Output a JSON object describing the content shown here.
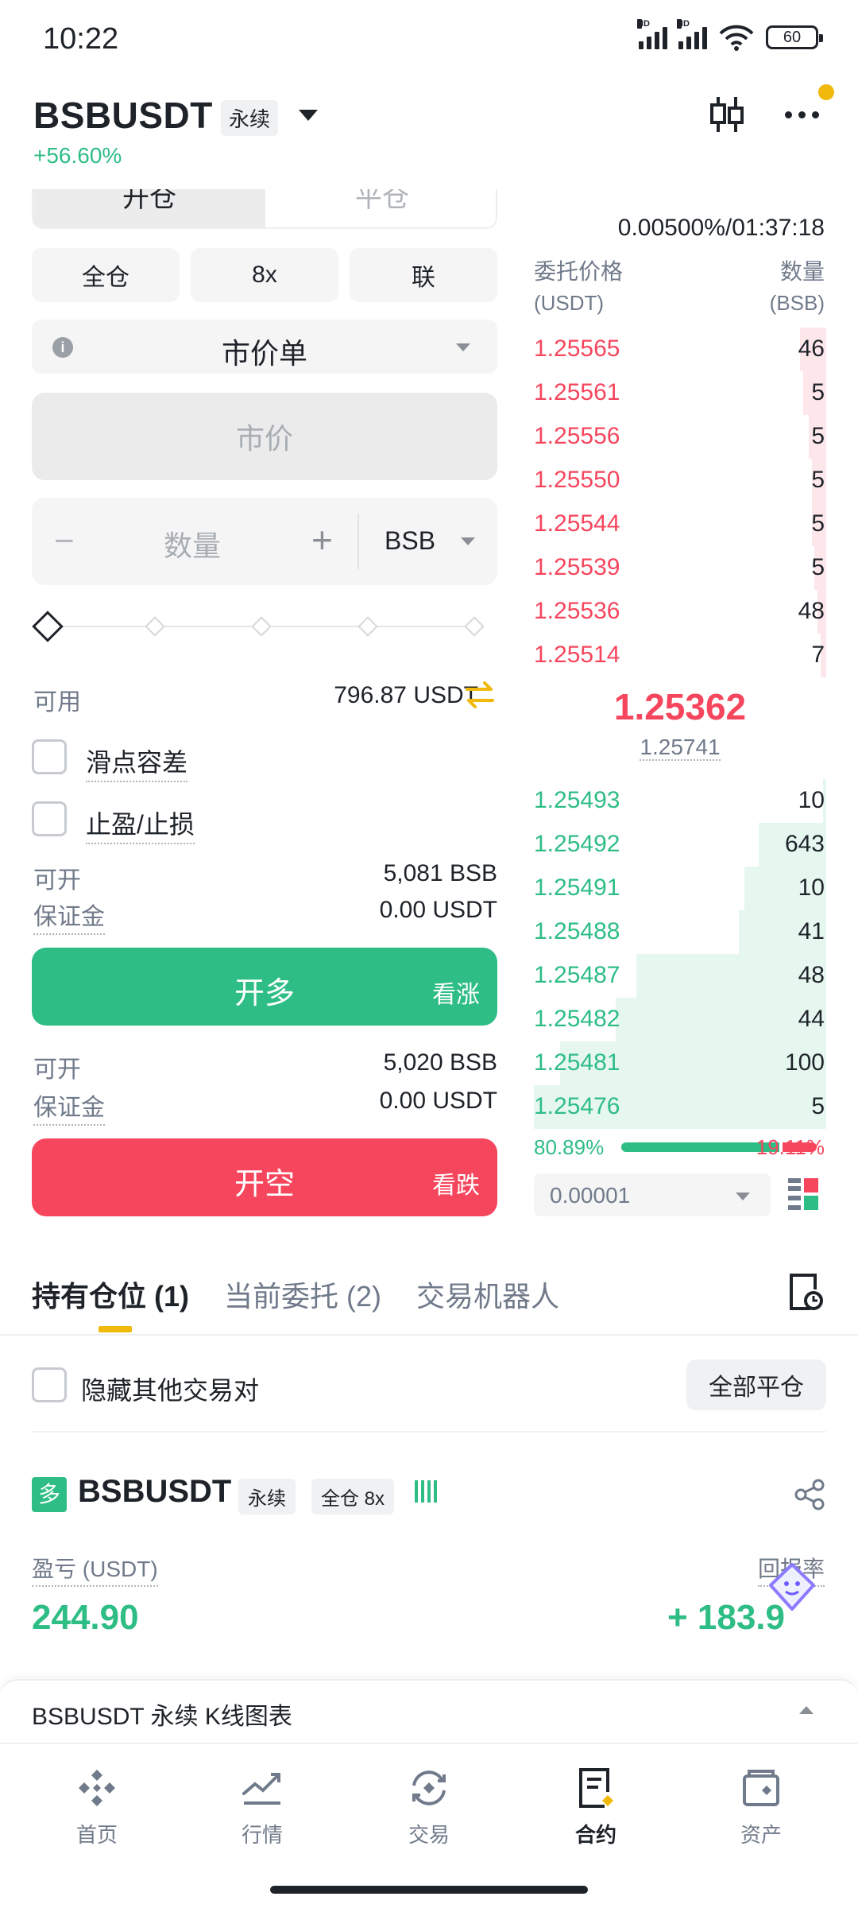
{
  "status_bar": {
    "time": "10:22",
    "battery": "60",
    "hd_label": "HD",
    "icons": [
      "signal-icon",
      "signal-icon",
      "wifi-icon",
      "battery-icon"
    ]
  },
  "header": {
    "symbol": "BSBUSDT",
    "contract_type": "永续",
    "change": "+56.60%"
  },
  "trade_form": {
    "tab_open": "开仓",
    "tab_close": "平仓",
    "margin_mode": "全仓",
    "leverage": "8x",
    "link_mode": "联",
    "order_type": "市价单",
    "price_placeholder": "市价",
    "qty_placeholder": "数量",
    "qty_unit": "BSB",
    "minus": "−",
    "plus": "+",
    "available_label": "可用",
    "available_value": "796.87 USDT",
    "slippage_label": "滑点容差",
    "tpsl_label": "止盈/止损",
    "long": {
      "max_label": "可开",
      "max_value": "5,081 BSB",
      "margin_label": "保证金",
      "margin_value": "0.00 USDT",
      "button": "开多",
      "button_sub": "看涨"
    },
    "short": {
      "max_label": "可开",
      "max_value": "5,020 BSB",
      "margin_label": "保证金",
      "margin_value": "0.00 USDT",
      "button": "开空",
      "button_sub": "看跌"
    }
  },
  "orderbook": {
    "funding_rate": "0.00500%/01:37:18",
    "price_header": "委托价格",
    "price_unit": "(USDT)",
    "qty_header": "数量",
    "qty_unit": "(BSB)",
    "asks": [
      {
        "price": "1.25565",
        "qty": "46",
        "depth": 0.09
      },
      {
        "price": "1.25561",
        "qty": "5",
        "depth": 0.08
      },
      {
        "price": "1.25556",
        "qty": "5",
        "depth": 0.06
      },
      {
        "price": "1.25550",
        "qty": "5",
        "depth": 0.05
      },
      {
        "price": "1.25544",
        "qty": "5",
        "depth": 0.05
      },
      {
        "price": "1.25539",
        "qty": "5",
        "depth": 0.04
      },
      {
        "price": "1.25536",
        "qty": "48",
        "depth": 0.03
      },
      {
        "price": "1.25514",
        "qty": "7",
        "depth": 0.02
      }
    ],
    "last_price": "1.25362",
    "mark_price": "1.25741",
    "bids": [
      {
        "price": "1.25493",
        "qty": "10",
        "depth": 0.01
      },
      {
        "price": "1.25492",
        "qty": "643",
        "depth": 0.23
      },
      {
        "price": "1.25491",
        "qty": "10",
        "depth": 0.28
      },
      {
        "price": "1.25488",
        "qty": "41",
        "depth": 0.3
      },
      {
        "price": "1.25487",
        "qty": "48",
        "depth": 0.65
      },
      {
        "price": "1.25482",
        "qty": "44",
        "depth": 0.72
      },
      {
        "price": "1.25481",
        "qty": "100",
        "depth": 0.91
      },
      {
        "price": "1.25476",
        "qty": "5",
        "depth": 1.0
      }
    ],
    "long_ratio": "80.89%",
    "short_ratio": "19.11%",
    "long_fraction": 0.8089,
    "precision": "0.00001"
  },
  "positions": {
    "tabs": [
      "持有仓位 (1)",
      "当前委托 (2)",
      "交易机器人"
    ],
    "hide_others_label": "隐藏其他交易对",
    "close_all": "全部平仓",
    "item": {
      "side": "多",
      "symbol": "BSBUSDT",
      "contract_type": "永续",
      "mode": "全仓 8x",
      "pnl_label": "盈亏 (USDT)",
      "pnl_value": "244.90",
      "roe_label": "回报率",
      "roe_value": "+ 183.9"
    }
  },
  "chart_bar": {
    "label": "BSBUSDT 永续 K线图表"
  },
  "nav": [
    {
      "label": "首页",
      "icon": "home-icon"
    },
    {
      "label": "行情",
      "icon": "markets-icon"
    },
    {
      "label": "交易",
      "icon": "trade-icon"
    },
    {
      "label": "合约",
      "icon": "futures-icon"
    },
    {
      "label": "资产",
      "icon": "wallet-icon"
    }
  ],
  "colors": {
    "up": "#2ebd85",
    "down": "#f6465d",
    "accent": "#f0b90b"
  }
}
